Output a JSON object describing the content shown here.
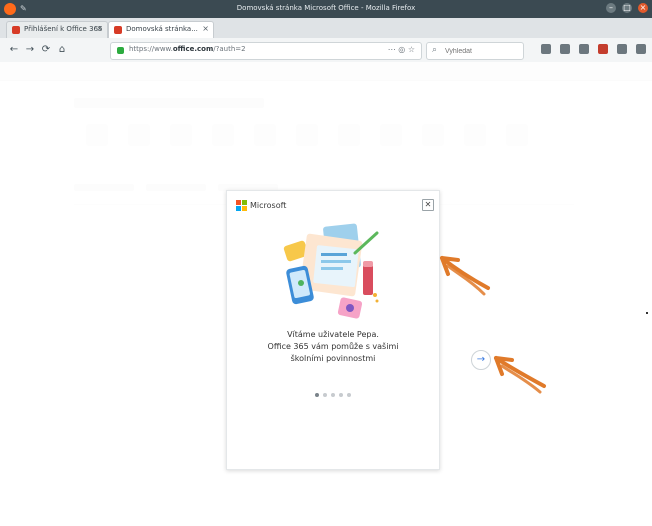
{
  "window": {
    "title": "Domovská stránka Microsoft Office - Mozilla Firefox"
  },
  "tabs": [
    {
      "label": "Přihlášení k Office 365 | © ×"
    },
    {
      "label": "Domovská stránka..."
    }
  ],
  "nav": {
    "url_prefix": "https://www.",
    "url_bold": "office.com",
    "url_suffix": "/?auth=2",
    "search_placeholder": "Vyhledat"
  },
  "welcome": {
    "brand": "Microsoft",
    "message_lines": [
      "Vítáme uživatele Pepa.",
      "Office 365 vám pomůže s vašimi",
      "školními povinnostmi"
    ]
  },
  "pagination": {
    "total": 5,
    "active_index": 0
  },
  "colors": {
    "microsoft_logo": [
      "#f35325",
      "#81bc06",
      "#05a6f0",
      "#ffba08"
    ],
    "arrow_annotation": "#e07a2a",
    "next_arrow": "#3b7be0"
  },
  "icons": {
    "close": "close-icon",
    "next": "arrow-right-icon"
  }
}
